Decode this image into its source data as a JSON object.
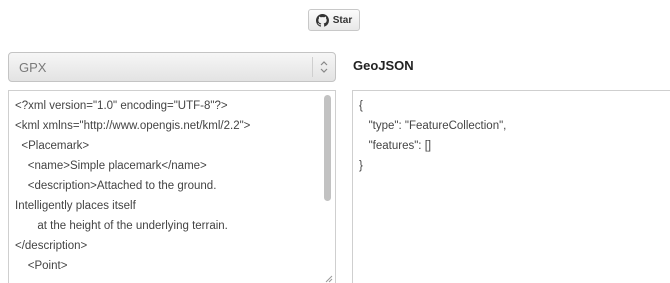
{
  "header": {
    "star_button": {
      "label": "Star",
      "icon": "github-icon"
    }
  },
  "input": {
    "format_select": {
      "value": "GPX"
    },
    "text": [
      "<?xml version=\"1.0\" encoding=\"UTF-8\"?>",
      "<kml xmlns=\"http://www.opengis.net/kml/2.2\">",
      "  <Placemark>",
      "    <name>Simple placemark</name>",
      "    <description>Attached to the ground.",
      "Intelligently places itself",
      "       at the height of the underlying terrain.",
      "</description>",
      "    <Point>"
    ]
  },
  "output": {
    "title": "GeoJSON",
    "text": [
      "{",
      "   \"type\": \"FeatureCollection\",",
      "   \"features\": []",
      "}"
    ]
  }
}
